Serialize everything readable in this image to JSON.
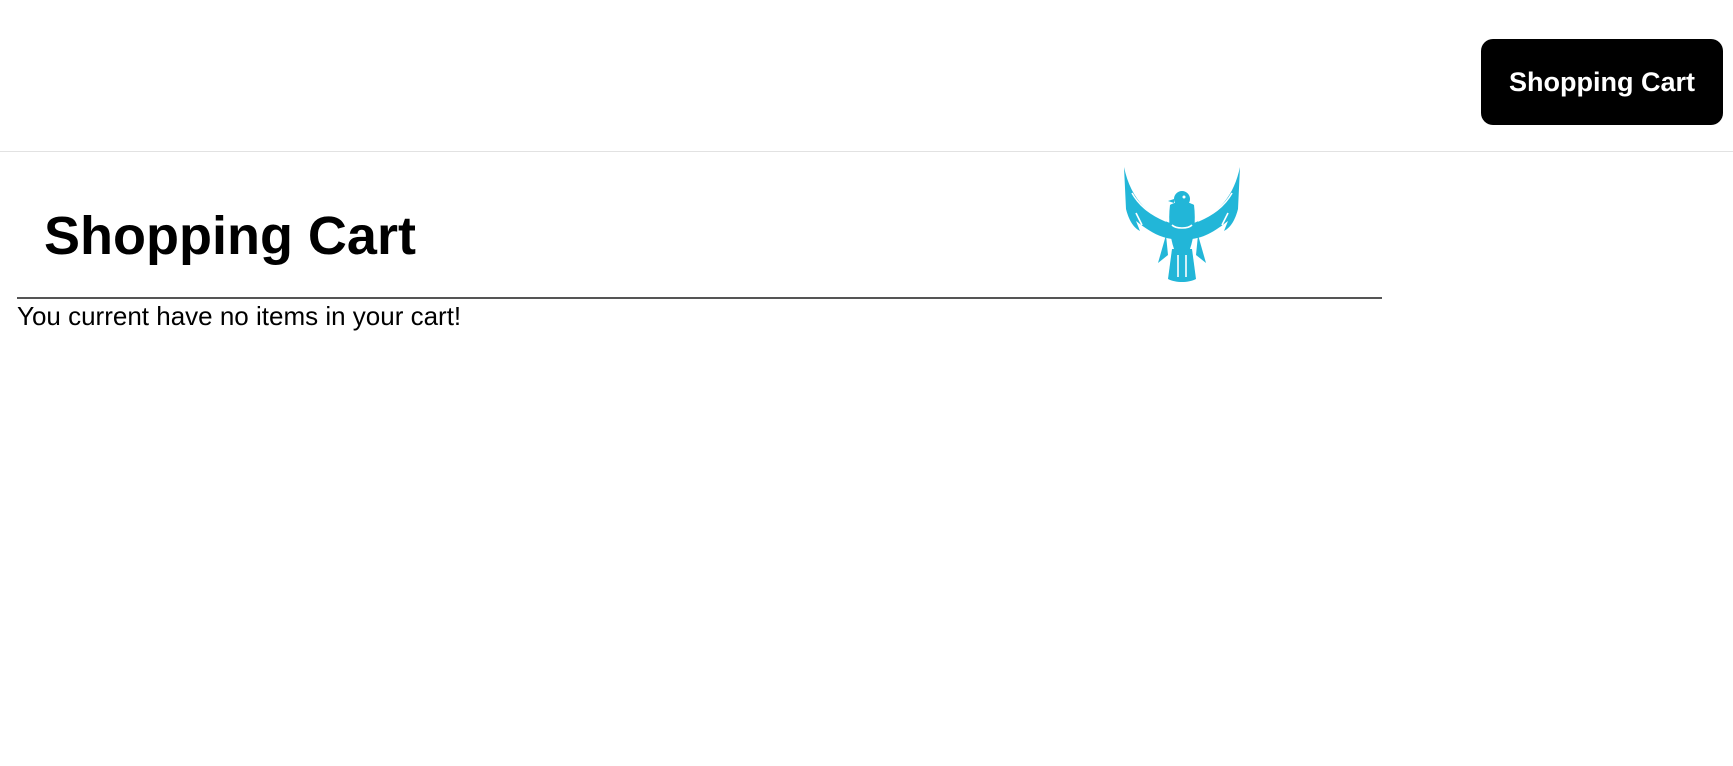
{
  "header": {
    "cart_button_label": "Shopping Cart"
  },
  "main": {
    "title": "Shopping Cart",
    "empty_message": "You current have no items in your cart!",
    "logo_icon": "eagle-logo-icon",
    "logo_color": "#22b6d8"
  }
}
